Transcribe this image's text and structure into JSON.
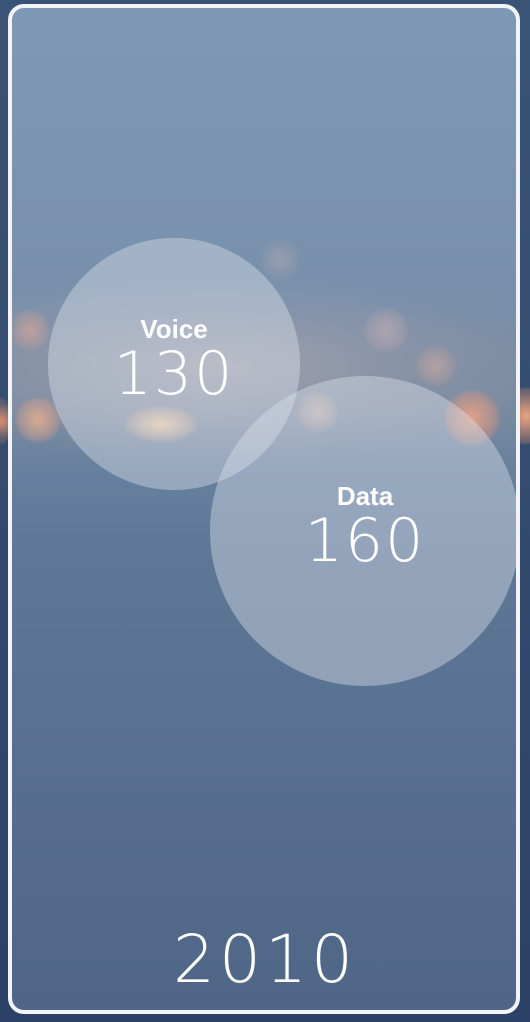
{
  "bubbles": {
    "voice": {
      "label": "Voice",
      "value": "130"
    },
    "data": {
      "label": "Data",
      "value": "160"
    }
  },
  "year": "2010",
  "colors": {
    "frame": "#f2f4f7",
    "text": "#ffffff",
    "bubble_fill": "rgba(220, 226, 236, 0.42)"
  }
}
